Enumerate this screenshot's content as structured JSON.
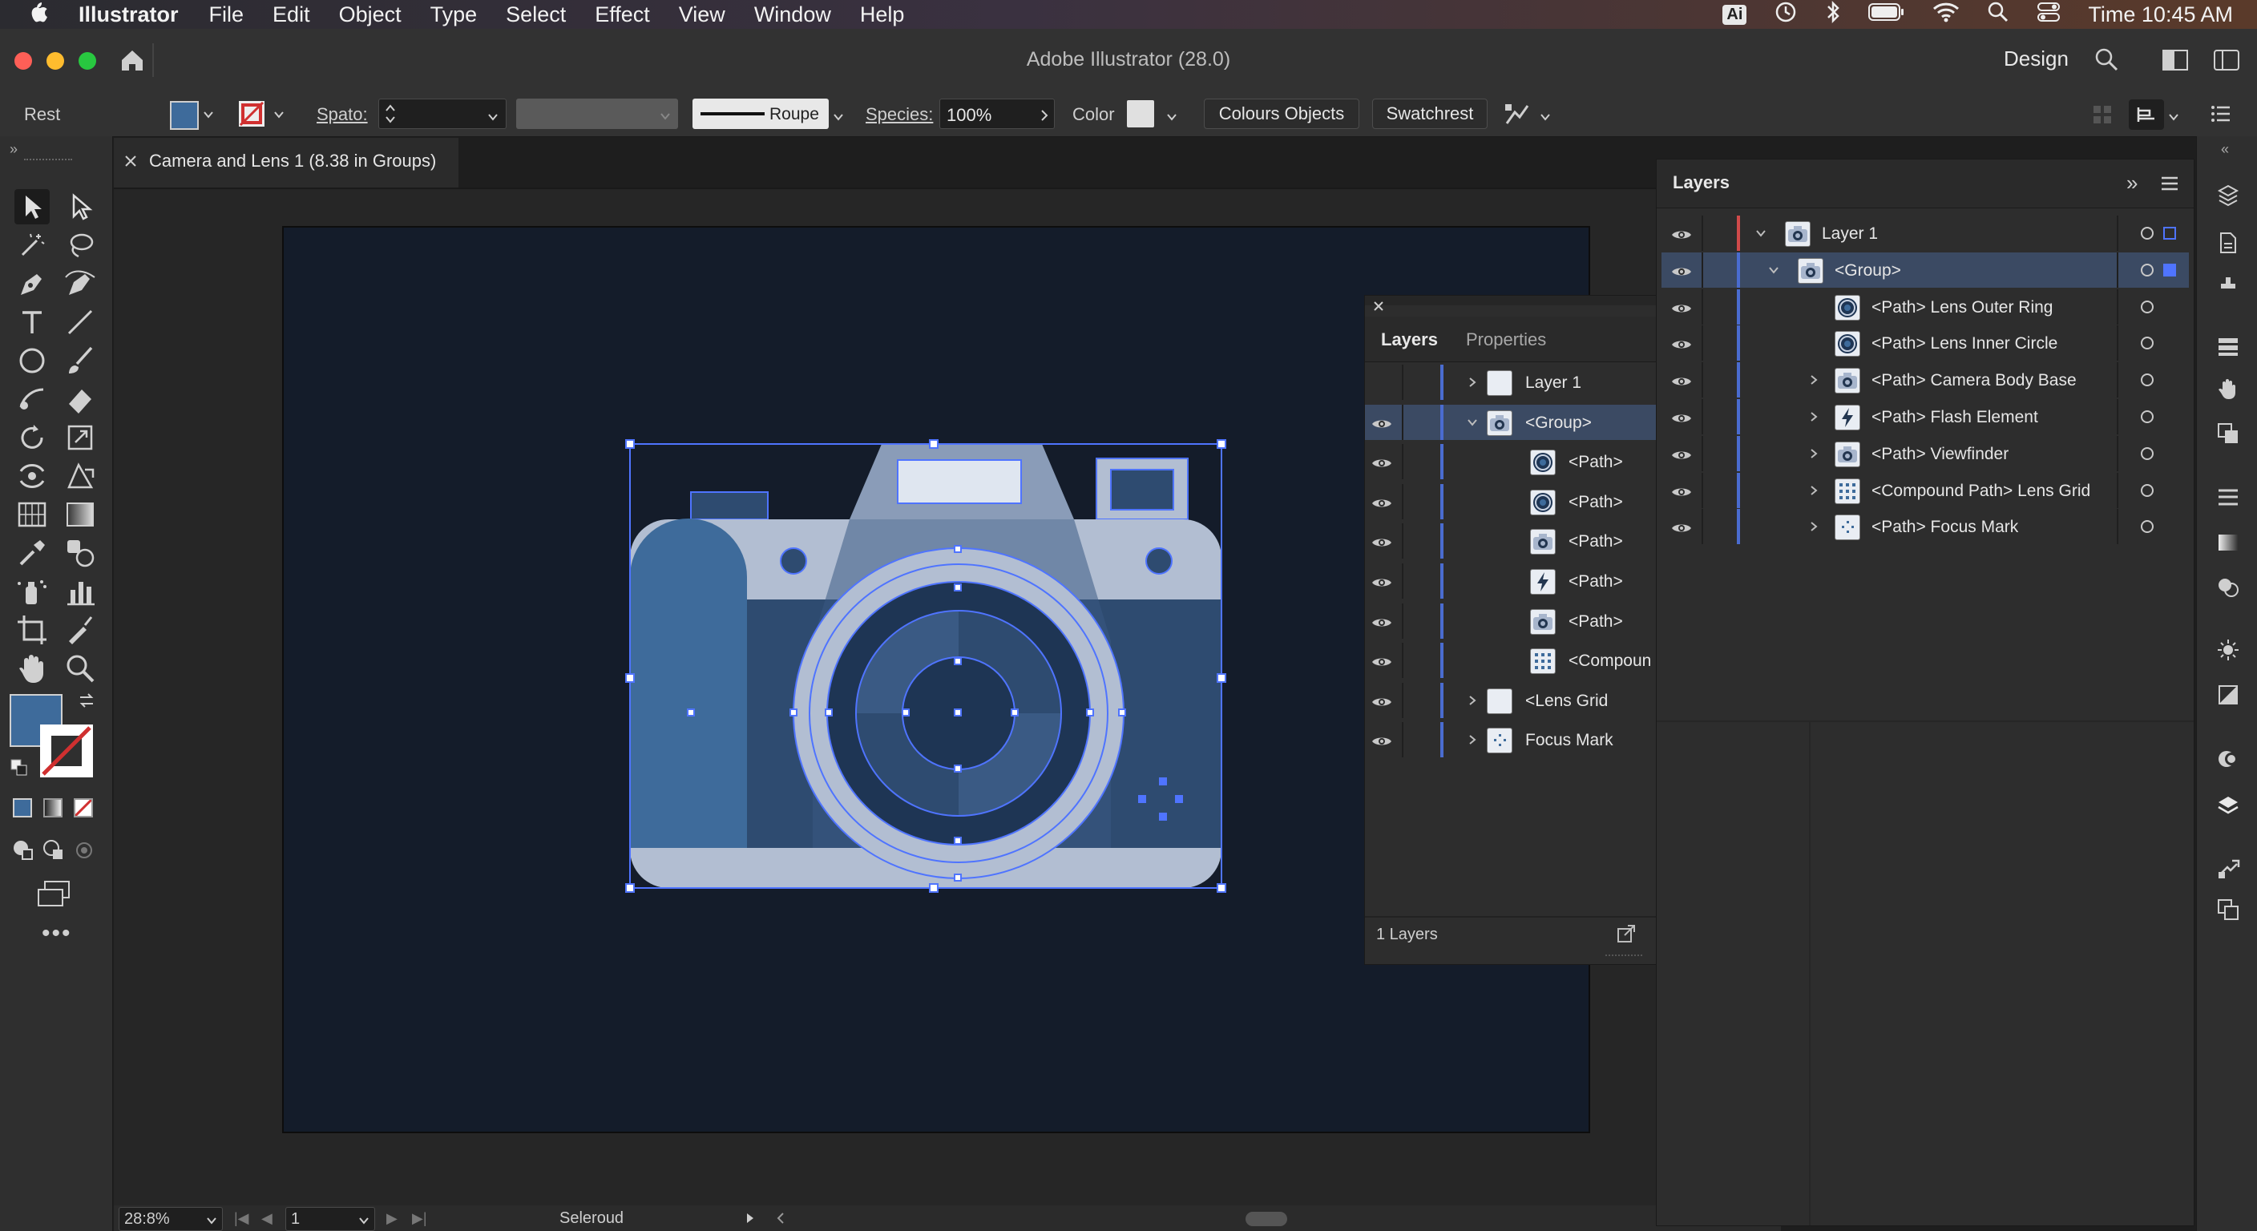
{
  "menubar": {
    "app": "Illustrator",
    "items": [
      "File",
      "Edit",
      "Object",
      "Type",
      "Select",
      "Effect",
      "View",
      "Window",
      "Help"
    ],
    "status_badge": "Ai",
    "clock": "Time 10:45 AM",
    "icons": [
      "apple-icon",
      "time-machine-icon",
      "bluetooth-icon",
      "battery-icon",
      "wifi-icon",
      "spotlight-search-icon",
      "control-center-icon"
    ]
  },
  "titlebar": {
    "title": "Adobe Illustrator (28.0)",
    "workspace": "Design"
  },
  "controlbar": {
    "state_label": "Rest",
    "spato_label": "Spato:",
    "stroke_style": "Roupe",
    "species_label": "Species:",
    "species_value": "100%",
    "color_label": "Color",
    "colours_objects_button": "Colours Objects",
    "swatchrest_button": "Swatchrest"
  },
  "document": {
    "tab_title": "Camera and Lens 1 (8.38 in Groups)"
  },
  "statusbar": {
    "zoom": "28:8%",
    "page": "1",
    "tool_status": "Seleroud"
  },
  "floating_panel": {
    "tabs": [
      "Layers",
      "Properties"
    ],
    "rows": [
      {
        "label": "Layer 1",
        "indent": 0,
        "expand": "collapsed",
        "selected": false,
        "thumb": "light",
        "eye": false
      },
      {
        "label": "<Group>",
        "indent": 0,
        "expand": "expanded",
        "selected": true,
        "thumb": "camera",
        "eye": true
      },
      {
        "label": "<Path>",
        "indent": 1,
        "expand": "none",
        "selected": false,
        "thumb": "ring",
        "eye": true
      },
      {
        "label": "<Path>",
        "indent": 1,
        "expand": "none",
        "selected": false,
        "thumb": "ring",
        "eye": true
      },
      {
        "label": "<Path>",
        "indent": 1,
        "expand": "none",
        "selected": false,
        "thumb": "camera",
        "eye": true
      },
      {
        "label": "<Path>",
        "indent": 1,
        "expand": "none",
        "selected": false,
        "thumb": "flash",
        "eye": true
      },
      {
        "label": "<Path>",
        "indent": 1,
        "expand": "none",
        "selected": false,
        "thumb": "camera",
        "eye": true
      },
      {
        "label": "<Compoun",
        "indent": 1,
        "expand": "none",
        "selected": false,
        "thumb": "grid",
        "eye": true
      },
      {
        "label": "<Lens Grid",
        "indent": 0,
        "expand": "collapsed",
        "selected": false,
        "thumb": "light",
        "eye": true
      },
      {
        "label": "Focus Mark",
        "indent": 0,
        "expand": "collapsed",
        "selected": false,
        "thumb": "dots",
        "eye": true
      }
    ],
    "footer_count": "1 Layers"
  },
  "main_panel": {
    "title": "Layers",
    "rows": [
      {
        "label": "Layer 1",
        "indent": 0,
        "expand": "expanded",
        "selected": false,
        "thumb": "camera"
      },
      {
        "label": "<Group>",
        "indent": 1,
        "expand": "expanded",
        "selected": true,
        "thumb": "camera"
      },
      {
        "label": "<Path> Lens Outer Ring",
        "indent": 2,
        "expand": "none",
        "selected": false,
        "thumb": "ring"
      },
      {
        "label": "<Path> Lens Inner Circle",
        "indent": 2,
        "expand": "none",
        "selected": false,
        "thumb": "ring"
      },
      {
        "label": "<Path> Camera Body Base",
        "indent": 2,
        "expand": "collapsed",
        "selected": false,
        "thumb": "camera"
      },
      {
        "label": "<Path> Flash Element",
        "indent": 2,
        "expand": "collapsed",
        "selected": false,
        "thumb": "flash"
      },
      {
        "label": "<Path> Viewfinder",
        "indent": 2,
        "expand": "collapsed",
        "selected": false,
        "thumb": "camera"
      },
      {
        "label": "<Compound Path> Lens Grid",
        "indent": 2,
        "expand": "collapsed",
        "selected": false,
        "thumb": "grid"
      },
      {
        "label": "<Path> Focus Mark",
        "indent": 2,
        "expand": "collapsed",
        "selected": false,
        "thumb": "dots"
      }
    ]
  },
  "colors": {
    "accent": "#4a6cd0",
    "fill_swatch": "#3e6b9b",
    "artboard": "#141c2a",
    "camera_light": "#b2bed2",
    "camera_mid": "#2e4b70",
    "camera_dark": "#1e3554",
    "selection": "#4f74ff"
  }
}
